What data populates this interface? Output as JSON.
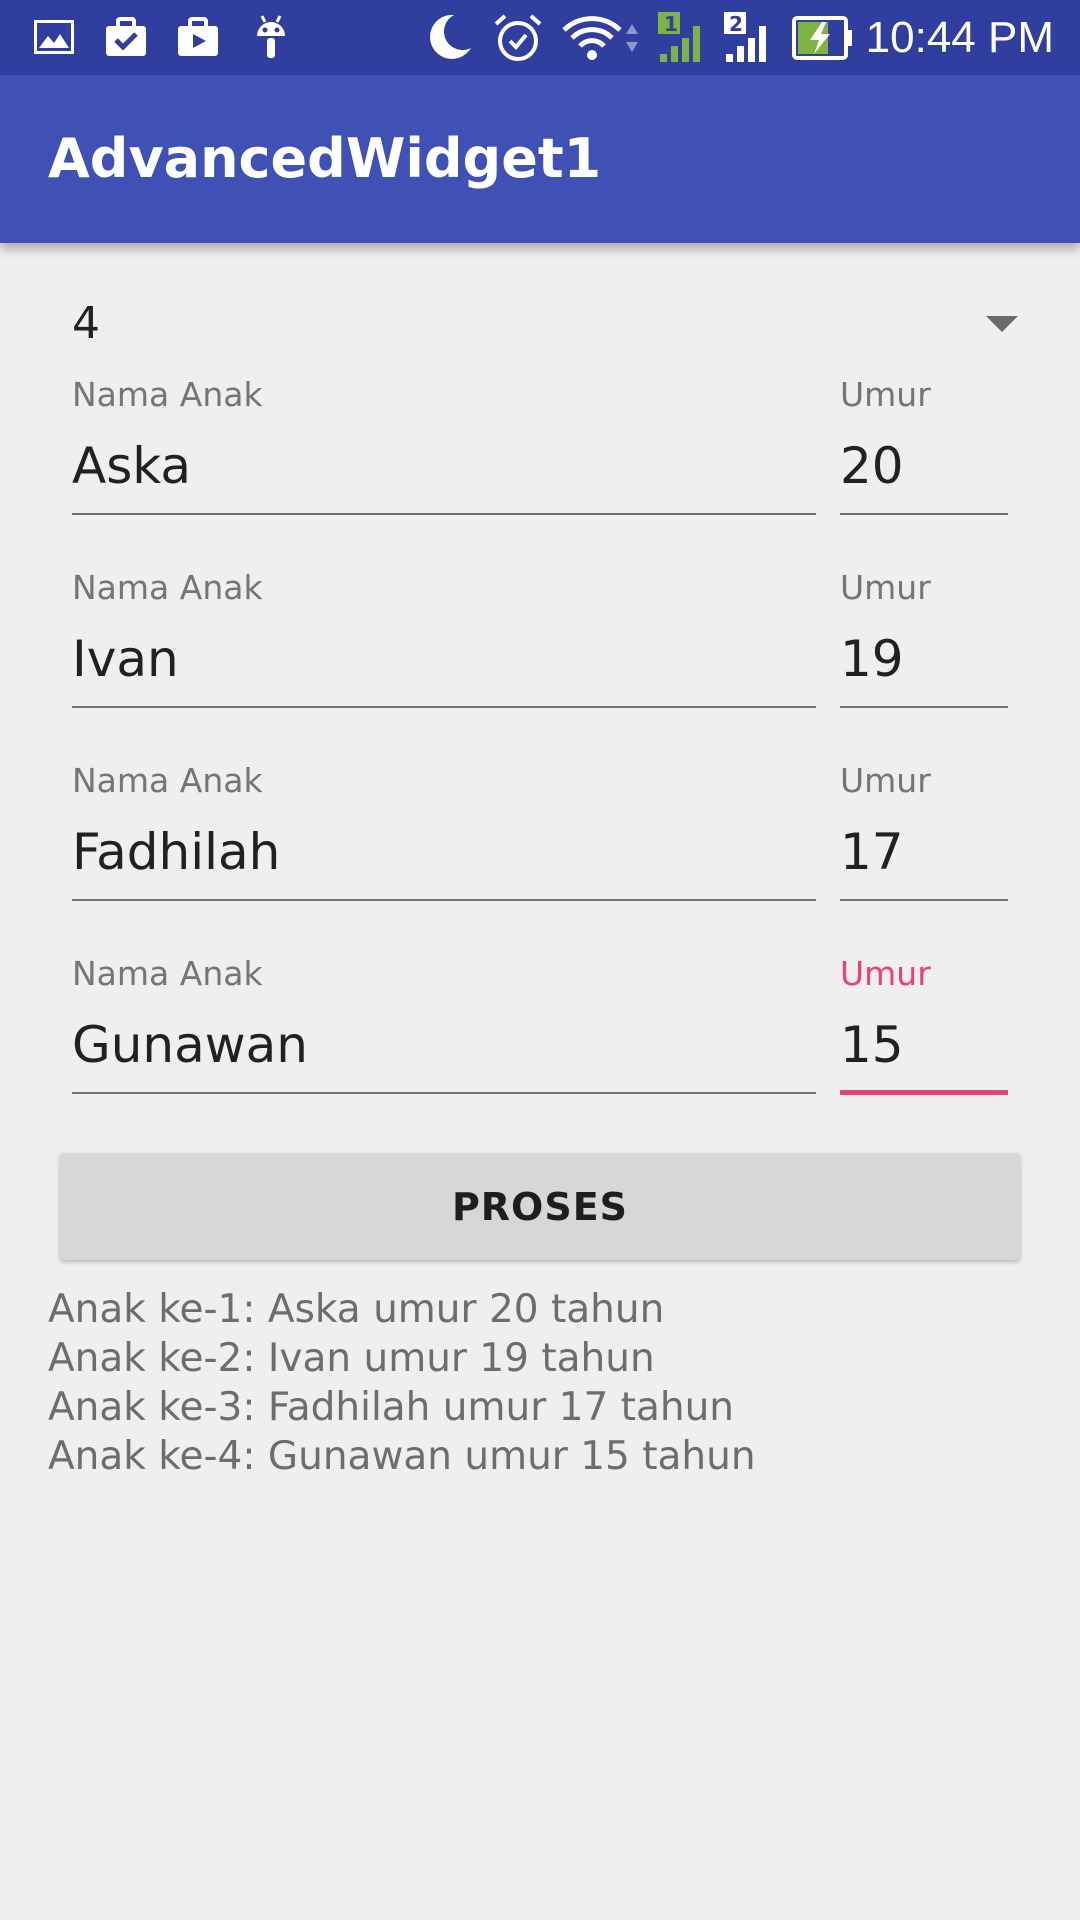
{
  "status_bar": {
    "time": "10:44 PM",
    "icons": [
      "image-icon",
      "briefcase-check-icon",
      "briefcase-play-icon",
      "android-icon",
      "moon-icon",
      "alarm-icon",
      "wifi-icon",
      "signal-1-icon",
      "signal-2-icon",
      "battery-charging-icon"
    ],
    "sim1_label": "1",
    "sim2_label": "2"
  },
  "app_bar": {
    "title": "AdvancedWidget1",
    "color": "#3f51b5"
  },
  "spinner": {
    "selected": "4"
  },
  "rows": [
    {
      "name_label": "Nama Anak",
      "name_value": "Aska",
      "age_label": "Umur",
      "age_value": "20"
    },
    {
      "name_label": "Nama Anak",
      "name_value": "Ivan",
      "age_label": "Umur",
      "age_value": "19"
    },
    {
      "name_label": "Nama Anak",
      "name_value": "Fadhilah",
      "age_label": "Umur",
      "age_value": "17"
    },
    {
      "name_label": "Nama Anak",
      "name_value": "Gunawan",
      "age_label": "Umur",
      "age_value": "15"
    }
  ],
  "focus_color": "#ec407a",
  "button": {
    "label": "PROSES"
  },
  "result_lines": [
    "Anak ke-1: Aska umur 20 tahun",
    "Anak ke-2: Ivan umur 19 tahun",
    "Anak ke-3: Fadhilah umur 17 tahun",
    "Anak ke-4: Gunawan umur 15 tahun"
  ]
}
